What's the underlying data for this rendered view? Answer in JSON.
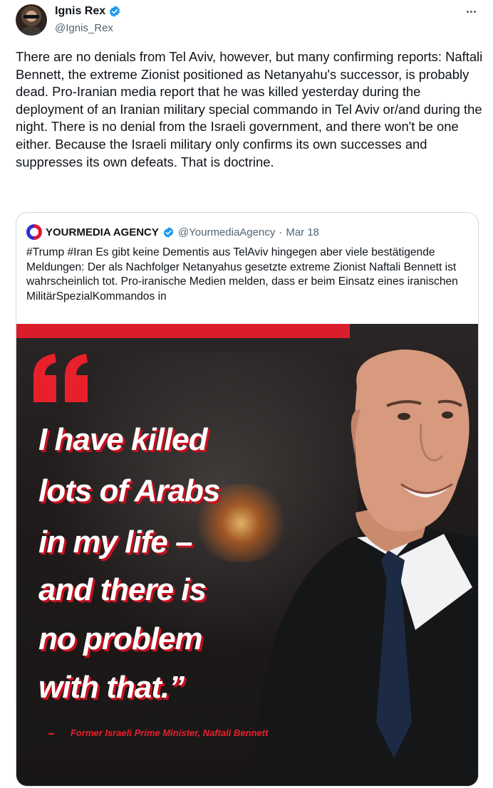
{
  "author": {
    "name": "Ignis Rex",
    "handle": "@Ignis_Rex"
  },
  "icons": {
    "verified": "verified-badge-icon",
    "more": "more-options-icon",
    "quote_logo": "yourmedia-agency-logo"
  },
  "colors": {
    "verified": "#1d9bf0",
    "text": "#0f1419",
    "secondary": "#536471",
    "accent_red": "#d91d2a"
  },
  "tweet": {
    "text": "There are no denials from Tel Aviv, however, but many confirming reports: Naftali Bennett, the extreme Zionist positioned as Netanyahu's successor, is probably dead. Pro-Iranian media report that he was killed yesterday during the deployment of an Iranian military special commando in Tel Aviv or/and during the night. There is no denial from the Israeli government, and there won't be one either. Because the Israeli military only confirms its own successes and suppresses its own defeats. That is doctrine."
  },
  "quote": {
    "name": "YOURMEDIA AGENCY",
    "handle": "@YourmediaAgency",
    "separator": "·",
    "date": "Mar 18",
    "text": "#Trump #Iran Es gibt keine Dementis aus TelAviv hingegen aber viele bestätigende Meldungen: Der als Nachfolger Netanyahus gesetzte extreme Zionist Naftali Bennett ist wahrscheinlich tot. Pro-iranische Medien melden, dass er beim Einsatz eines iranischen MilitärSpezialKommandos in",
    "image": {
      "quote_lines": [
        "I have killed",
        "lots of Arabs",
        "in my life –",
        "and there is",
        "no problem",
        "with that.”"
      ],
      "attribution": "Former Israeli Prime Minister, Naftali Bennett"
    }
  }
}
